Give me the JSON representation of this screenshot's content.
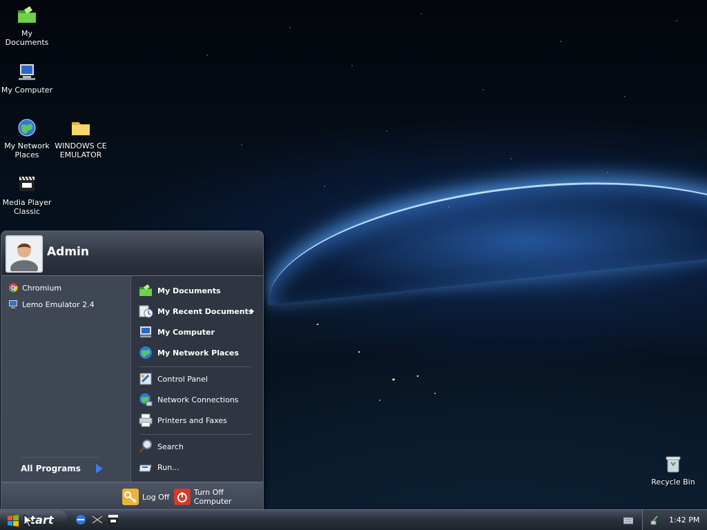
{
  "desktop": {
    "icons": [
      {
        "label": "My Documents",
        "icon": "folder-green-icon"
      },
      {
        "label": "My Computer",
        "icon": "computer-icon"
      },
      {
        "label_line1": "My Network",
        "label_line2": "Places",
        "icon": "network-globe-icon"
      },
      {
        "label_line1": "WINDOWS CE",
        "label_line2": "EMULATOR",
        "icon": "folder-yellow-icon"
      },
      {
        "label_line1": "Media Player",
        "label_line2": "Classic",
        "icon": "media-player-icon"
      },
      {
        "label": "Recycle Bin",
        "icon": "recycle-bin-icon"
      }
    ]
  },
  "start_menu": {
    "user_name": "Admin",
    "pinned": [
      {
        "label": "Chromium",
        "icon": "chromium-icon"
      },
      {
        "label": "Lemo Emulator 2.4",
        "icon": "monitor-icon"
      }
    ],
    "all_programs": "All Programs",
    "right": {
      "group1": [
        {
          "label": "My Documents",
          "icon": "folder-green-icon"
        },
        {
          "label": "My Recent Documents",
          "icon": "recent-documents-icon"
        },
        {
          "label": "My Computer",
          "icon": "computer-icon"
        },
        {
          "label": "My Network Places",
          "icon": "network-globe-icon"
        }
      ],
      "group2": [
        {
          "label": "Control Panel",
          "icon": "control-panel-icon"
        },
        {
          "label": "Network Connections",
          "icon": "network-connections-icon"
        },
        {
          "label": "Printers and Faxes",
          "icon": "printer-icon"
        }
      ],
      "group3": [
        {
          "label": "Search",
          "icon": "search-icon"
        },
        {
          "label": "Run...",
          "icon": "run-icon"
        }
      ]
    },
    "footer": {
      "log_off": "Log Off",
      "turn_off": "Turn Off Computer"
    }
  },
  "taskbar": {
    "start_label": "start",
    "clock": "1:42 PM"
  },
  "colors": {
    "accent_blue": "#3b7bf0",
    "menu_bg": "#3a4150",
    "taskbar_bg": "#2c323c"
  }
}
